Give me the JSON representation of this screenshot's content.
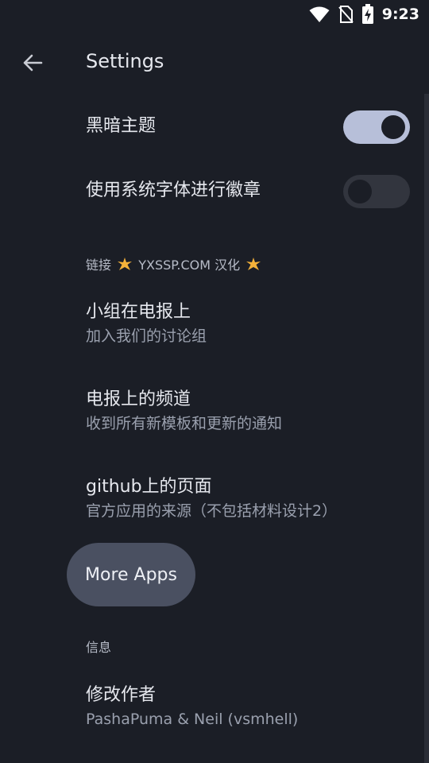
{
  "status_bar": {
    "time": "9:23",
    "icons": [
      "wifi-icon",
      "no-sim-icon",
      "battery-charging-icon"
    ]
  },
  "app_bar": {
    "title": "Settings",
    "back_icon": "arrow-left-icon"
  },
  "colors": {
    "background": "#1b1e26",
    "switch_on_track": "#b7bfd9",
    "switch_off_track": "#32353e",
    "pill_background": "#4a5061",
    "accent_star": "#f4b23a"
  },
  "preferences": [
    {
      "title": "黑暗主题",
      "switch_on": true
    },
    {
      "title": "使用系统字体进行徽章",
      "switch_on": false
    }
  ],
  "links_category": {
    "prefix": "链接",
    "site": "YXSSP.COM",
    "suffix": "汉化",
    "star_icon": "sparkle-star-icon"
  },
  "links": [
    {
      "title": "小组在电报上",
      "summary": "加入我们的讨论组"
    },
    {
      "title": "电报上的频道",
      "summary": "收到所有新模板和更新的通知"
    },
    {
      "title": "github上的页面",
      "summary": "官方应用的来源（不包括材料设计2）"
    }
  ],
  "more_apps_label": "More Apps",
  "info_category": "信息",
  "author": {
    "title": "修改作者",
    "summary": "PashaPuma & Neil (vsmhell)"
  }
}
